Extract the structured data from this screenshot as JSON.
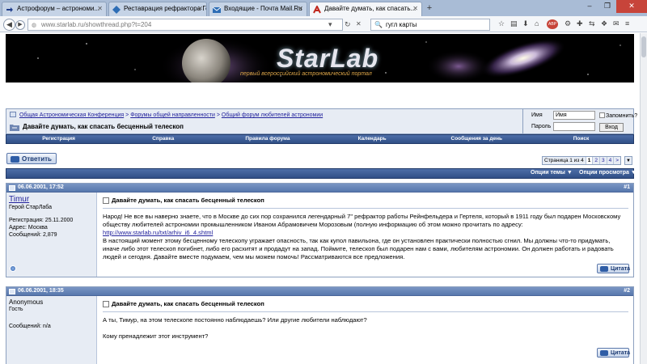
{
  "browser": {
    "tabs": [
      {
        "label": "Астрофорум – астрономи...",
        "icon": "arrow-icon"
      },
      {
        "label": "Реставрация рефрактора Ге...",
        "icon": "diamond-icon"
      },
      {
        "label": "Входящие - Почта Mail.Ru",
        "icon": "mail-icon"
      },
      {
        "label": "Давайте думать, как спасать...",
        "icon": "starlab-icon"
      }
    ],
    "url": "www.starlab.ru/showthread.php?t=204",
    "search_value": "гугл карты",
    "new_tab": "+"
  },
  "banner": {
    "logo": "StarLab",
    "slogan": "первый всероссийский астрономический портал"
  },
  "breadcrumb": {
    "items": [
      "Общая Астрономическая Конференция",
      "Форумы общей направленности",
      "Общий форум любителей астрономии"
    ],
    "separator": ">",
    "thread_title": "Давайте думать, как спасать бесценный телескоп"
  },
  "login": {
    "name_label": "Имя",
    "name_value": "Имя",
    "password_label": "Пароль",
    "remember_label": "Запомнить?",
    "submit_label": "Вход"
  },
  "menu": [
    "Регистрация",
    "Справка",
    "Правила форума",
    "Календарь",
    "Сообщения за день",
    "Поиск"
  ],
  "reply_button": "Ответить",
  "pager": {
    "summary": "Страница 1 из 4",
    "pages": [
      "1",
      "2",
      "3",
      "4"
    ],
    "next": ">",
    "current": "1",
    "dropdown": "▼"
  },
  "tools": {
    "thread_options": "Опции темы ▼",
    "view_options": "Опции просмотра ▼"
  },
  "posts": [
    {
      "date": "06.06.2001, 17:52",
      "number": "#1",
      "username": "Timur",
      "user_title": "Герой СтарЛаба",
      "info": [
        "Регистрация: 25.11.2000",
        "Адрес: Москва",
        "Сообщений: 2,879"
      ],
      "title": "Давайте думать, как спасать бесценный телескоп",
      "text_1": "Народ! Не все вы наверно знаете, что в Москве до сих пор сохранился легендарный 7\" рефрактор работы Рейнфельдера и Гертеля, который в 1911 году был подарен Московскому обществу любителей астрономии промышленником Иваном Абрамовичем Морозовым (полную информацию об этом можно прочитать по адресу: ",
      "link": "http://www.starlab.ru/txt/arhiv_i6_4.shtml",
      "text_2": "В настоящий момент этому бесценному телескопу угражает опасность, так как купол павильона, где он установлен практически полностью сгнил. Мы должны что-то придумать, иначе либо этот телескоп погибнет, либо его расхитят и продадут на запад. Поймите, телескоп был подарен нам с вами, любителям астрономии. Он должен работать и радовать людей и сегодня. Давайте вместе подумаем, чем мы можем помочь! Рассматриваются все предложения.",
      "quote": "Цитата"
    },
    {
      "date": "06.06.2001, 18:35",
      "number": "#2",
      "username": "Anonymous",
      "user_title": "Гость",
      "info": [
        "Сообщений: n/a"
      ],
      "title": "Давайте думать, как спасать бесценный телескоп",
      "text_1": "А ты, Тимур, на этом телескопе постоянно наблюдаешь? Или другие любители наблюдают?",
      "text_2": "Кому пренадлежит этот инструмент?",
      "quote": "Цитата"
    }
  ],
  "colors": {
    "header_blue": "#304f86",
    "panel_bg": "#e7ecf4",
    "link": "#22229c",
    "slogan": "#e0a84a"
  }
}
